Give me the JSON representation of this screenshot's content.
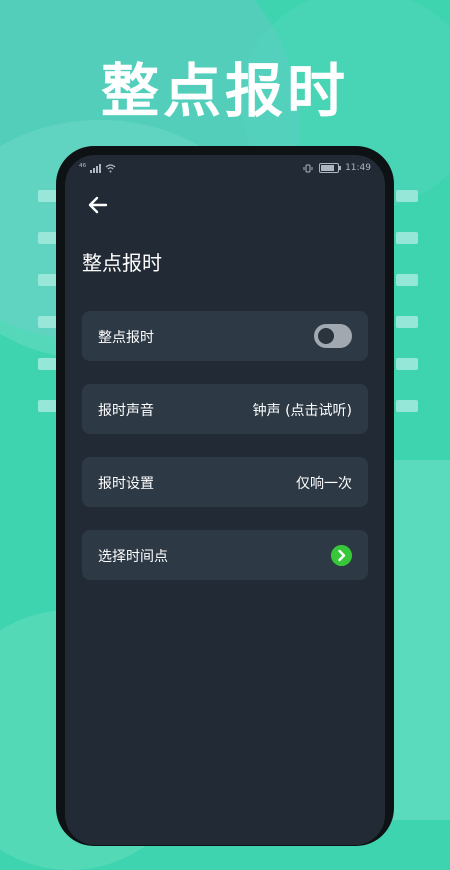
{
  "hero": {
    "title": "整点报时"
  },
  "status_bar": {
    "time": "11:49",
    "signal": "⁴⁶"
  },
  "header": {
    "title": "整点报时"
  },
  "settings": [
    {
      "id": "hourly_chime",
      "label": "整点报时",
      "type": "toggle",
      "enabled": false
    },
    {
      "id": "chime_sound",
      "label": "报时声音",
      "value": "钟声 (点击试听)"
    },
    {
      "id": "chime_setting",
      "label": "报时设置",
      "value": "仅响一次"
    },
    {
      "id": "choose_time",
      "label": "选择时间点",
      "type": "link"
    }
  ],
  "colors": {
    "accent": "#37c83a",
    "background": "#3fd4b0",
    "screen": "#222b35",
    "card": "#2d3945"
  },
  "icons": {
    "back": "back-arrow-icon",
    "chevron": "chevron-right-icon"
  }
}
